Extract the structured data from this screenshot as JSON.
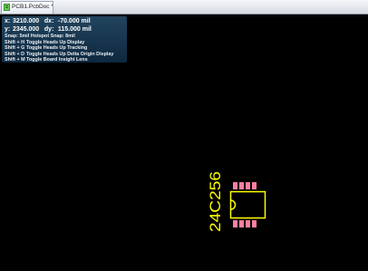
{
  "tab": {
    "label": "PCB1.PcbDoc *",
    "icon": "pcb-document-icon"
  },
  "hud": {
    "x_label": "x:",
    "x_value": "3210.000",
    "dx_label": "dx:",
    "dx_value": "-70.000 mil",
    "y_label": "y:",
    "y_value": "2345.000",
    "dy_label": "dy:",
    "dy_value": "115.000 mil",
    "snap": "Snap: 5mil Hotspot Snap: 8mil",
    "shortcuts": [
      {
        "key": "Shift + H",
        "action": "Toggle Heads Up Display"
      },
      {
        "key": "Shift + G",
        "action": "Toggle Heads Up Tracking"
      },
      {
        "key": "Shift + D",
        "action": "Toggle Heads Up Delta Origin Display"
      },
      {
        "key": "Shift + M",
        "action": "Toggle Board Insight Lens"
      }
    ]
  },
  "component": {
    "designator": "24C256",
    "outline_color": "#ffff00",
    "pad_color": "#ff7f9f"
  }
}
